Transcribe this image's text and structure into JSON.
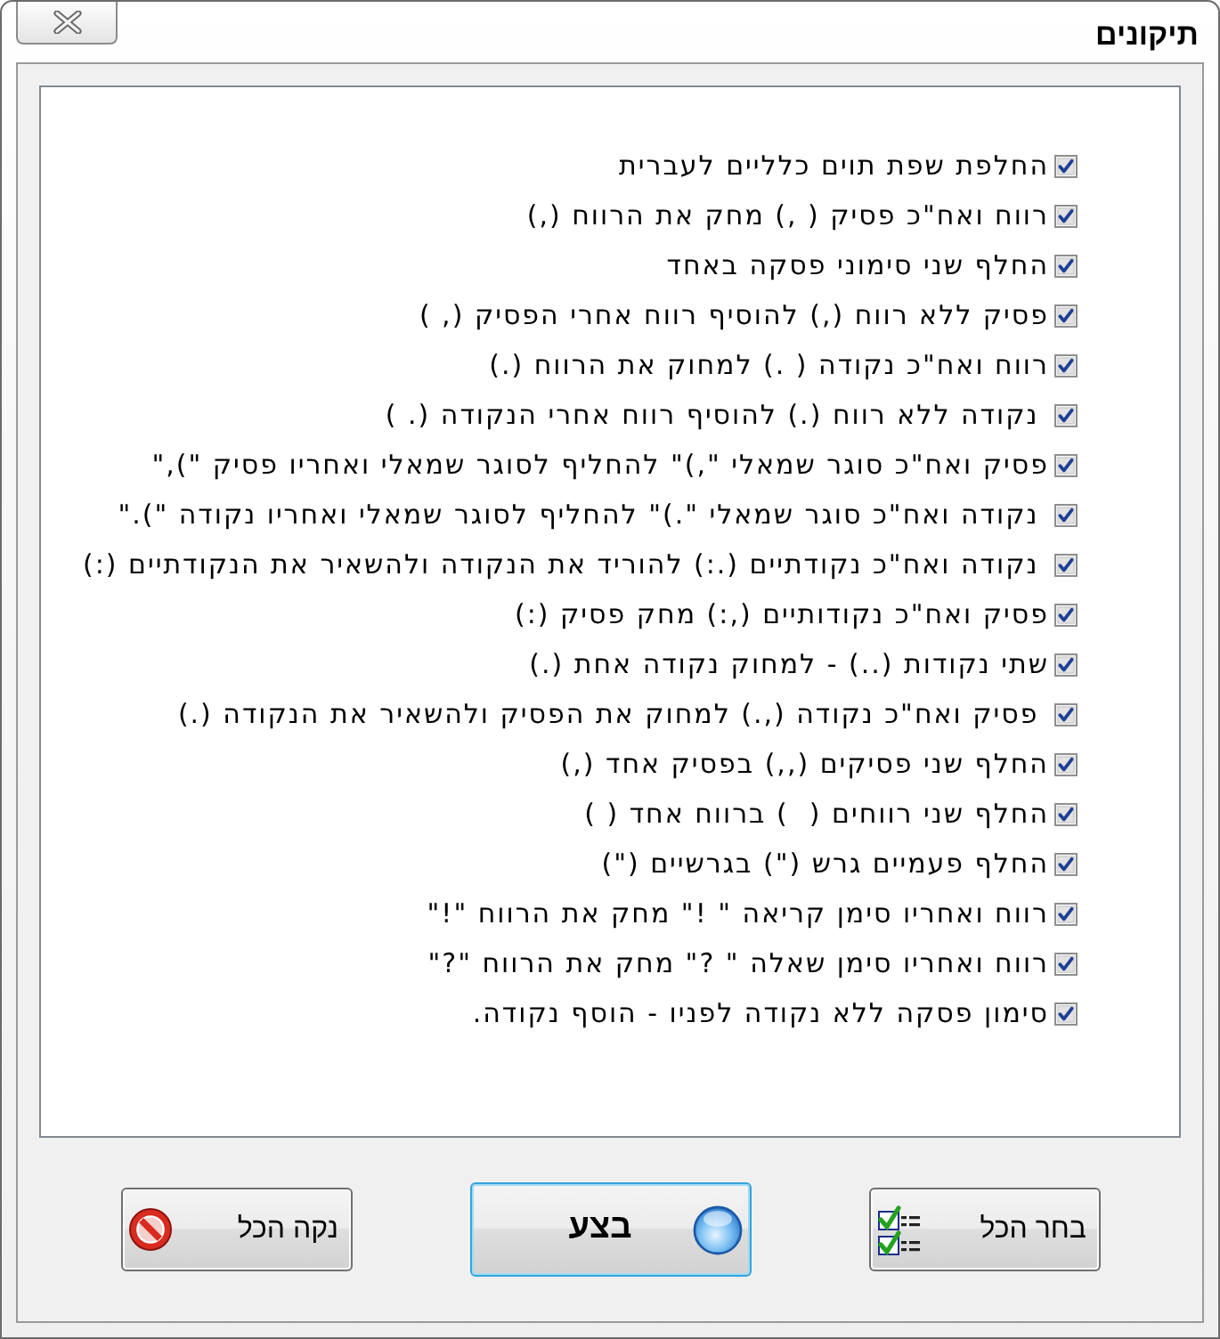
{
  "window": {
    "title": "תיקונים"
  },
  "options": [
    {
      "label": "החלפת שפת תוים כלליים לעברית",
      "checked": true
    },
    {
      "label": "רווח ואח\"כ פסיק ( ,) מחק את הרווח (,)",
      "checked": true
    },
    {
      "label": "החלף שני סימוני פסקה באחד",
      "checked": true
    },
    {
      "label": "פסיק ללא רווח (,) להוסיף רווח אחרי הפסיק (, )",
      "checked": true
    },
    {
      "label": "רווח ואח\"כ נקודה ( .) למחוק את הרווח (.)",
      "checked": true
    },
    {
      "label": " נקודה ללא רווח (.) להוסיף רווח אחרי הנקודה (. )",
      "checked": true
    },
    {
      "label": "פסיק ואח\"כ סוגר שמאלי \",)\" להחליף לסוגר שמאלי ואחריו פסיק \"),\"",
      "checked": true
    },
    {
      "label": " נקודה ואח\"כ סוגר שמאלי \".)\" להחליף לסוגר שמאלי ואחריו נקודה \").\"",
      "checked": true
    },
    {
      "label": " נקודה ואח\"כ נקודתיים (.:) להוריד את הנקודה ולהשאיר את הנקודתיים (:)",
      "checked": true
    },
    {
      "label": "פסיק ואח\"כ נקודותיים (,:) מחק פסיק (:)",
      "checked": true
    },
    {
      "label": "שתי נקודות (..) - למחוק נקודה אחת (.)",
      "checked": true
    },
    {
      "label": " פסיק ואח\"כ נקודה (,.) למחוק את הפסיק ולהשאיר את הנקודה (.)",
      "checked": true
    },
    {
      "label": "החלף שני פסיקים (,,) בפסיק אחד (,)",
      "checked": true
    },
    {
      "label": "החלף שני רווחים (  ) ברווח אחד ( )",
      "checked": true
    },
    {
      "label": "החלף פעמיים גרש (\") בגרשיים (\")",
      "checked": true
    },
    {
      "label": "רווח ואחריו סימן קריאה \" !\" מחק את הרווח \"!\"",
      "checked": true
    },
    {
      "label": "רווח ואחריו סימן שאלה \" ?\" מחק את הרווח \"?\"",
      "checked": true
    },
    {
      "label": "סימון פסקה ללא נקודה לפניו - הוסף נקודה.",
      "checked": true
    }
  ],
  "buttons": [
    {
      "kind": "check_all",
      "label": "בחר הכל",
      "default": false
    },
    {
      "kind": "run",
      "label": "בצע",
      "default": true
    },
    {
      "kind": "clear",
      "label": "נקה הכל",
      "default": false
    }
  ]
}
